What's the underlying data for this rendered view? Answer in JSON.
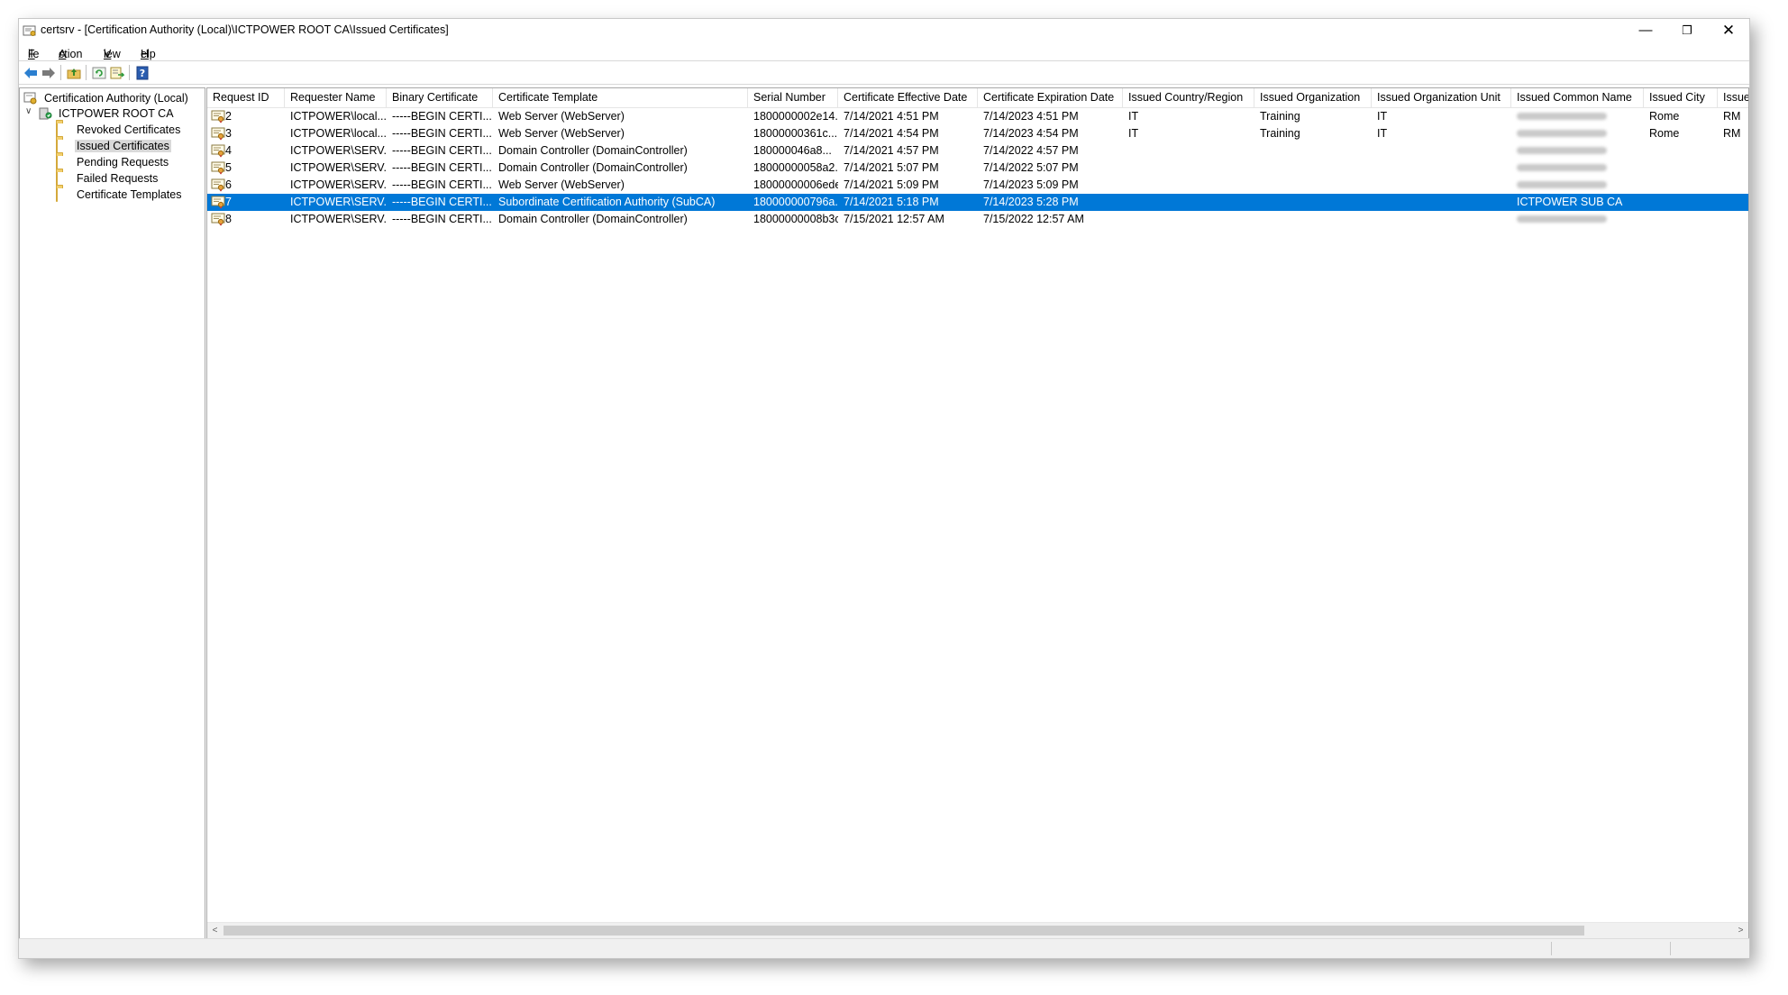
{
  "window": {
    "title": "certsrv - [Certification Authority (Local)\\ICTPOWER ROOT CA\\Issued Certificates]",
    "minimize": "—",
    "maximize": "❐",
    "close": "✕"
  },
  "menu": [
    {
      "mnemonic": "F",
      "rest": "ile"
    },
    {
      "mnemonic": "A",
      "rest": "ction"
    },
    {
      "mnemonic": "V",
      "rest": "iew"
    },
    {
      "mnemonic": "H",
      "rest": "elp"
    }
  ],
  "toolbar": {
    "icons": [
      "back-arrow-icon",
      "forward-arrow-icon",
      "up-folder-icon",
      "refresh-icon",
      "export-list-icon",
      "help-icon"
    ]
  },
  "tree": {
    "root": "Certification Authority (Local)",
    "ca": "ICTPOWER ROOT CA",
    "expander": "∨",
    "folders": [
      "Revoked Certificates",
      "Issued Certificates",
      "Pending Requests",
      "Failed Requests",
      "Certificate Templates"
    ],
    "selected": "Issued Certificates"
  },
  "columns": [
    "Request ID",
    "Requester Name",
    "Binary Certificate",
    "Certificate Template",
    "Serial Number",
    "Certificate Effective Date",
    "Certificate Expiration Date",
    "Issued Country/Region",
    "Issued Organization",
    "Issued Organization Unit",
    "Issued Common Name",
    "Issued City",
    "Issued"
  ],
  "rows": [
    {
      "id": "2",
      "requester": "ICTPOWER\\local...",
      "binary": "-----BEGIN CERTI...",
      "template": "Web Server (WebServer)",
      "serial": "1800000002e14...",
      "effective": "7/14/2021 4:51 PM",
      "expiration": "7/14/2023 4:51 PM",
      "country": "IT",
      "org": "Training",
      "ou": "IT",
      "cn": "",
      "city": "Rome",
      "state": "RM",
      "cn_redacted": true,
      "selected": false
    },
    {
      "id": "3",
      "requester": "ICTPOWER\\local...",
      "binary": "-----BEGIN CERTI...",
      "template": "Web Server (WebServer)",
      "serial": "18000000361c...",
      "effective": "7/14/2021 4:54 PM",
      "expiration": "7/14/2023 4:54 PM",
      "country": "IT",
      "org": "Training",
      "ou": "IT",
      "cn": "",
      "city": "Rome",
      "state": "RM",
      "cn_redacted": true,
      "selected": false
    },
    {
      "id": "4",
      "requester": "ICTPOWER\\SERV...",
      "binary": "-----BEGIN CERTI...",
      "template": "Domain Controller (DomainController)",
      "serial": "180000046a8...",
      "effective": "7/14/2021 4:57 PM",
      "expiration": "7/14/2022 4:57 PM",
      "country": "",
      "org": "",
      "ou": "",
      "cn": "",
      "city": "",
      "state": "",
      "cn_redacted": true,
      "selected": false
    },
    {
      "id": "5",
      "requester": "ICTPOWER\\SERV...",
      "binary": "-----BEGIN CERTI...",
      "template": "Domain Controller (DomainController)",
      "serial": "18000000058a2...",
      "effective": "7/14/2021 5:07 PM",
      "expiration": "7/14/2022 5:07 PM",
      "country": "",
      "org": "",
      "ou": "",
      "cn": "",
      "city": "",
      "state": "",
      "cn_redacted": true,
      "selected": false
    },
    {
      "id": "6",
      "requester": "ICTPOWER\\SERV...",
      "binary": "-----BEGIN CERTI...",
      "template": "Web Server (WebServer)",
      "serial": "18000000006ede...",
      "effective": "7/14/2021 5:09 PM",
      "expiration": "7/14/2023 5:09 PM",
      "country": "",
      "org": "",
      "ou": "",
      "cn": "",
      "city": "",
      "state": "",
      "cn_redacted": true,
      "selected": false
    },
    {
      "id": "7",
      "requester": "ICTPOWER\\SERV...",
      "binary": "-----BEGIN CERTI...",
      "template": "Subordinate Certification Authority (SubCA)",
      "serial": "180000000796a...",
      "effective": "7/14/2021 5:18 PM",
      "expiration": "7/14/2023 5:28 PM",
      "country": "",
      "org": "",
      "ou": "",
      "cn": "ICTPOWER SUB CA",
      "city": "",
      "state": "",
      "cn_redacted": false,
      "selected": true
    },
    {
      "id": "8",
      "requester": "ICTPOWER\\SERV...",
      "binary": "-----BEGIN CERTI...",
      "template": "Domain Controller (DomainController)",
      "serial": "18000000008b3c...",
      "effective": "7/15/2021 12:57 AM",
      "expiration": "7/15/2022 12:57 AM",
      "country": "",
      "org": "",
      "ou": "",
      "cn": "",
      "city": "",
      "state": "",
      "cn_redacted": true,
      "selected": false
    }
  ],
  "scrollbar": {
    "left_arrow": "<",
    "right_arrow": ">"
  },
  "colors": {
    "selection": "#0078d7",
    "folder": "#f2cf6d"
  }
}
